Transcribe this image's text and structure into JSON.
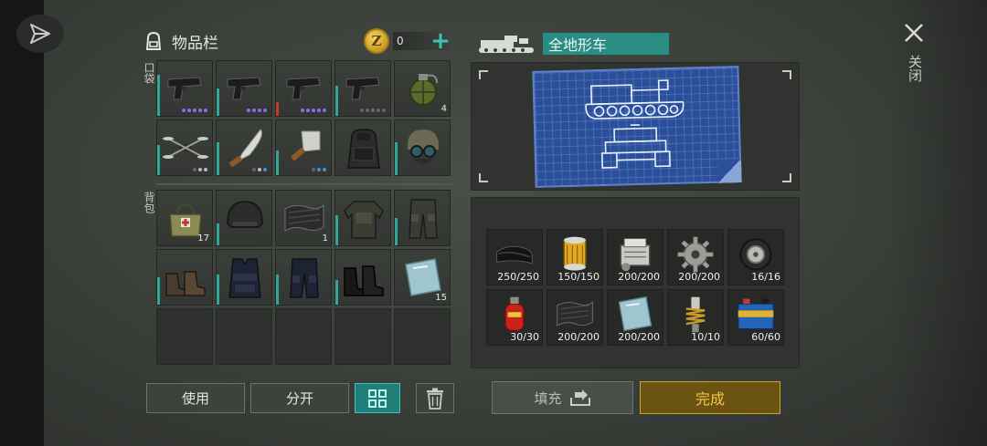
{
  "inventory": {
    "title": "物品栏",
    "coins": "0",
    "coin_symbol": "Z",
    "plus": "+",
    "pocket_label": "口袋",
    "bag_label": "背包",
    "pocket_slots": [
      {
        "icon": "pistol-icon",
        "dots": [
          "#8a6df0",
          "#8a6df0",
          "#8a6df0",
          "#8a6df0",
          "#8a6df0"
        ],
        "bar": "teal",
        "durability": 0.75
      },
      {
        "icon": "pistol-icon",
        "dots": [
          "#8a6df0",
          "#8a6df0",
          "#8a6df0",
          "#8a6df0"
        ],
        "bar": "teal",
        "durability": 0.5
      },
      {
        "icon": "pistol-icon",
        "dots": [
          "#8a6df0",
          "#8a6df0",
          "#8a6df0",
          "#8a6df0",
          "#8a6df0"
        ],
        "bar": "red",
        "durability": 0.25
      },
      {
        "icon": "pistol-icon",
        "dots": [
          "#666",
          "#666",
          "#666",
          "#666",
          "#666"
        ],
        "bar": "teal",
        "durability": 0.55
      },
      {
        "icon": "grenade-icon",
        "qty": "4"
      },
      {
        "icon": "drone-icon",
        "dots": [
          "#666",
          "#bbb",
          "#bbb"
        ],
        "bar": "teal",
        "durability": 0.55
      },
      {
        "icon": "machete-icon",
        "dots": [
          "#666",
          "#bbb",
          "#4a90d9"
        ],
        "bar": "teal",
        "durability": 0.6
      },
      {
        "icon": "cleaver-icon",
        "dots": [
          "#666",
          "#4a90d9",
          "#4a90d9"
        ],
        "bar": "teal",
        "durability": 0.45
      },
      {
        "icon": "backpack-icon"
      },
      {
        "icon": "gasmask-helmet-icon",
        "bar": "teal",
        "durability": 0.6
      }
    ],
    "bag_slots": [
      {
        "icon": "medkit-bag-icon",
        "qty": "17"
      },
      {
        "icon": "helmet-icon",
        "bar": "teal",
        "durability": 0.4
      },
      {
        "icon": "rubber-sheet-icon",
        "qty": "1"
      },
      {
        "icon": "camo-jacket-icon",
        "bar": "teal",
        "durability": 0.55
      },
      {
        "icon": "camo-pants-icon",
        "bar": "teal",
        "durability": 0.5
      },
      {
        "icon": "boots-icon",
        "bar": "teal",
        "durability": 0.5
      },
      {
        "icon": "police-vest-icon",
        "bar": "teal",
        "durability": 0.55
      },
      {
        "icon": "police-pants-icon",
        "bar": "teal",
        "durability": 0.55
      },
      {
        "icon": "police-boots-icon",
        "bar": "teal",
        "durability": 0.45
      },
      {
        "icon": "glass-pane-icon",
        "qty": "15"
      },
      {},
      {},
      {},
      {},
      {}
    ]
  },
  "buttons": {
    "use": "使用",
    "split": "分开",
    "sort_icon": "grid-sort-icon",
    "trash_icon": "trash-icon"
  },
  "vehicle": {
    "name": "全地形车",
    "icon": "atv-tank-icon"
  },
  "parts": [
    {
      "icon": "rubber-icon",
      "count": "250/250"
    },
    {
      "icon": "oil-filter-icon",
      "count": "150/150"
    },
    {
      "icon": "engine-block-icon",
      "count": "200/200"
    },
    {
      "icon": "gear-icon",
      "count": "200/200"
    },
    {
      "icon": "wheel-icon",
      "count": "16/16"
    },
    {
      "icon": "gas-cylinder-icon",
      "count": "30/30"
    },
    {
      "icon": "rubber-sheet-icon",
      "count": "200/200"
    },
    {
      "icon": "glass-pane-icon",
      "count": "200/200"
    },
    {
      "icon": "shock-absorber-icon",
      "count": "10/10"
    },
    {
      "icon": "battery-icon",
      "count": "60/60"
    }
  ],
  "actions": {
    "fill": "填充",
    "done": "完成",
    "close_label": "关闭"
  },
  "colors": {
    "accent_teal": "#2a8d84",
    "done_gold": "#f6c445",
    "rarity_purple": "#8a6df0"
  }
}
